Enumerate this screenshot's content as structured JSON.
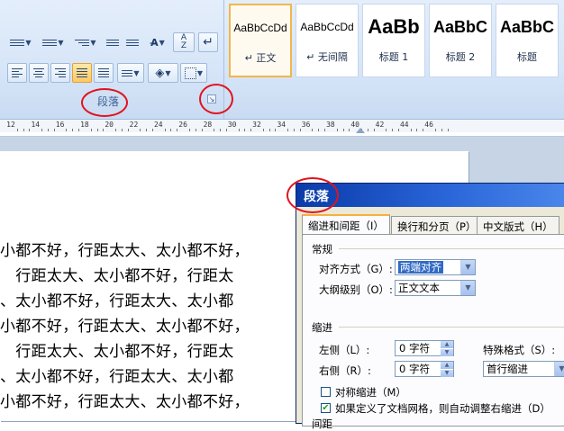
{
  "ribbon": {
    "paragraph_group_label": "段落",
    "styles": [
      {
        "sample": "AaBbCcDd",
        "name": "↵ 正文",
        "selected": true
      },
      {
        "sample": "AaBbCcDd",
        "name": "↵ 无间隔",
        "selected": false
      },
      {
        "sample": "AaBb",
        "name": "标题 1",
        "selected": false
      },
      {
        "sample": "AaBbC",
        "name": "标题 2",
        "selected": false
      },
      {
        "sample": "AaBbC",
        "name": "标题",
        "selected": false
      }
    ]
  },
  "ruler": {
    "ticks": [
      "12",
      "14",
      "16",
      "18",
      "20",
      "22",
      "24",
      "26",
      "28",
      "30",
      "32",
      "34",
      "36",
      "38",
      "40",
      "42",
      "44",
      "46"
    ]
  },
  "document": {
    "lines": [
      "小都不好，行距太大、太小都不好，",
      "　行距太大、太小都不好，行距太",
      "、太小都不好，行距太大、太小都",
      "小都不好，行距太大、太小都不好，",
      "　行距太大、太小都不好，行距太",
      "、太小都不好，行距太大、太小都",
      "小都不好，行距太大、太小都不好，"
    ]
  },
  "dialog": {
    "title": "段落",
    "tabs": [
      "缩进和间距（I）",
      "换行和分页（P）",
      "中文版式（H）"
    ],
    "section_general": "常规",
    "alignment_label": "对齐方式（G）:",
    "alignment_value": "两端对齐",
    "outline_label": "大纲级别（O）:",
    "outline_value": "正文文本",
    "section_indent": "缩进",
    "left_label": "左侧（L）:",
    "left_value": "0 字符",
    "right_label": "右侧（R）:",
    "right_value": "0 字符",
    "special_label": "特殊格式（S）:",
    "special_value": "首行缩进",
    "mirror_label": "对称缩进（M）",
    "mirror_checked": false,
    "grid_label": "如果定义了文档网格，则自动调整右缩进（D）",
    "grid_checked": true,
    "section_spacing": "间距"
  }
}
